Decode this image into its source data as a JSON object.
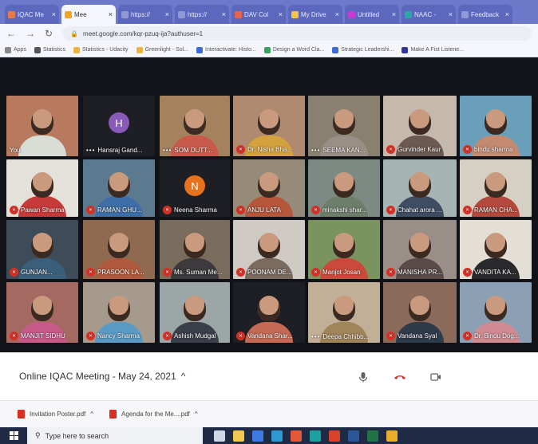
{
  "browser": {
    "tabs": [
      {
        "label": "IQAC Me",
        "active": false,
        "color": "#e67c4a"
      },
      {
        "label": "Mee",
        "active": true,
        "color": "#f4a622"
      },
      {
        "label": "https://",
        "active": false,
        "color": "#8f99d6"
      },
      {
        "label": "https://",
        "active": false,
        "color": "#8f99d6"
      },
      {
        "label": "DAV Col",
        "active": false,
        "color": "#e9644c"
      },
      {
        "label": "My Drive",
        "active": false,
        "color": "#f5c542"
      },
      {
        "label": "Untitled",
        "active": false,
        "color": "#c53bd3"
      },
      {
        "label": "NAAC -",
        "active": false,
        "color": "#2aa6a6"
      },
      {
        "label": "Feedback",
        "active": false,
        "color": "#8f99d6"
      }
    ],
    "url": "meet.google.com/kqr-pzuq-ija?authuser=1",
    "bookmarks": [
      {
        "label": "Apps",
        "color": "#888888"
      },
      {
        "label": "Statistics",
        "color": "#555555"
      },
      {
        "label": "Statistics - Udacity",
        "color": "#f0b23a"
      },
      {
        "label": "Greenlight - Sol...",
        "color": "#f0b23a"
      },
      {
        "label": "Interactivate: Histo...",
        "color": "#3b6bd3"
      },
      {
        "label": "Design a Word Cla...",
        "color": "#3aa35a"
      },
      {
        "label": "Strategic Leadershi...",
        "color": "#3b6bd3"
      },
      {
        "label": "Make A Fist Listene...",
        "color": "#333399"
      }
    ]
  },
  "participants": [
    {
      "name": "You",
      "muted": false,
      "more": false,
      "avatar": "",
      "bg": "#b77a5e",
      "body": "#d9ddd6"
    },
    {
      "name": "Hansraj Gand...",
      "muted": false,
      "more": true,
      "avatar": "H",
      "avatar_color": "#8a5ab8",
      "bg": "#1d1f24",
      "body": ""
    },
    {
      "name": "SOM DUTT...",
      "muted": false,
      "more": true,
      "avatar": "",
      "bg": "#a4825e",
      "body": "#c95a4a"
    },
    {
      "name": "Dr. Nisha Bha...",
      "muted": true,
      "more": false,
      "avatar": "",
      "bg": "#b08a70",
      "body": "#d4a13f"
    },
    {
      "name": "SEEMA KAN...",
      "muted": false,
      "more": true,
      "avatar": "",
      "bg": "#8a8070",
      "body": "#9a8f84"
    },
    {
      "name": "Gurvinder Kaur",
      "muted": true,
      "more": false,
      "avatar": "",
      "bg": "#c4b9aa",
      "body": "#6c5a52"
    },
    {
      "name": "bindu sharma",
      "muted": true,
      "more": false,
      "avatar": "",
      "bg": "#6a9fb9",
      "body": "#c48a70"
    },
    {
      "name": "Pawan Sharma",
      "muted": true,
      "more": false,
      "avatar": "",
      "bg": "#e4e1da",
      "body": "#c73a3a"
    },
    {
      "name": "RAMAN GHU...",
      "muted": true,
      "more": false,
      "avatar": "",
      "bg": "#5b7a8f",
      "body": "#3d6ea8"
    },
    {
      "name": "Neena Sharma",
      "muted": true,
      "more": false,
      "avatar": "N",
      "avatar_color": "#e8711c",
      "bg": "#1d1f24",
      "body": ""
    },
    {
      "name": "ANJU LATA",
      "muted": true,
      "more": false,
      "avatar": "",
      "bg": "#968a78",
      "body": "#b6573c"
    },
    {
      "name": "minakshi shar...",
      "muted": true,
      "more": false,
      "avatar": "",
      "bg": "#7d8a84",
      "body": "#6d7f6a"
    },
    {
      "name": "Chahat arora ...",
      "muted": true,
      "more": false,
      "avatar": "",
      "bg": "#a6b4b4",
      "body": "#3f4d63"
    },
    {
      "name": "RAMAN CHA...",
      "muted": true,
      "more": false,
      "avatar": "",
      "bg": "#d6cfc4",
      "body": "#b4483c"
    },
    {
      "name": "GUNJAN...",
      "muted": true,
      "more": false,
      "avatar": "",
      "bg": "#3d4c58",
      "body": "#3b5e7a"
    },
    {
      "name": "PRASOON LA...",
      "muted": true,
      "more": false,
      "avatar": "",
      "bg": "#8f6a50",
      "body": "#b05a3d"
    },
    {
      "name": "Ms. Suman Me...",
      "muted": true,
      "more": false,
      "avatar": "",
      "bg": "#7a6c5c",
      "body": "#3c3a3c"
    },
    {
      "name": "POONAM DE...",
      "muted": true,
      "more": false,
      "avatar": "",
      "bg": "#cfcbc4",
      "body": "#7b6a5e"
    },
    {
      "name": "Manjot Josan",
      "muted": true,
      "more": false,
      "avatar": "",
      "bg": "#7a9460",
      "body": "#c94a3a"
    },
    {
      "name": "MANISHA PR...",
      "muted": true,
      "more": false,
      "avatar": "",
      "bg": "#9a8f88",
      "body": "#5b4a4a"
    },
    {
      "name": "VANDITA KA...",
      "muted": true,
      "more": false,
      "avatar": "",
      "bg": "#e3ded6",
      "body": "#2a2a2e"
    },
    {
      "name": "MANJIT SIDHU",
      "muted": true,
      "more": false,
      "avatar": "",
      "bg": "#a46a62",
      "body": "#c85a8a"
    },
    {
      "name": "Nancy Sharma",
      "muted": true,
      "more": false,
      "avatar": "",
      "bg": "#a69a8c",
      "body": "#5a9ac4"
    },
    {
      "name": "Ashish Mudgal",
      "muted": true,
      "more": false,
      "avatar": "",
      "bg": "#9ca6a6",
      "body": "#3a3f4a"
    },
    {
      "name": "Vandana Shar...",
      "muted": true,
      "more": false,
      "avatar": "",
      "bg": "#1d1f24",
      "body": "#c46a54"
    },
    {
      "name": "Deepa Chhibb...",
      "muted": false,
      "more": true,
      "avatar": "",
      "bg": "#c2af98",
      "body": "#a0845a"
    },
    {
      "name": "Vandana Syal",
      "muted": true,
      "more": false,
      "avatar": "",
      "bg": "#8a6a5a",
      "body": "#2f3a4a"
    },
    {
      "name": "Dr. Bindu Dog...",
      "muted": true,
      "more": false,
      "avatar": "",
      "bg": "#8ba0b4",
      "body": "#d08a92"
    }
  ],
  "meeting": {
    "title": "Online IQAC Meeting - May 24, 2021",
    "chevron": "^"
  },
  "downloads": [
    {
      "label": "Invitation Poster.pdf"
    },
    {
      "label": "Agenda for the Me....pdf"
    }
  ],
  "taskbar": {
    "search_placeholder": "Type here to search",
    "apps": [
      {
        "name": "task-view",
        "color": "#cfd6e6"
      },
      {
        "name": "file-explorer",
        "color": "#f2c94c"
      },
      {
        "name": "mail",
        "color": "#3d7be0"
      },
      {
        "name": "edge",
        "color": "#2e9ad0"
      },
      {
        "name": "chrome",
        "color": "#e05a3a"
      },
      {
        "name": "chrome-2",
        "color": "#1fa0a0"
      },
      {
        "name": "office",
        "color": "#d9432c"
      },
      {
        "name": "word",
        "color": "#2b579a"
      },
      {
        "name": "excel",
        "color": "#217346"
      },
      {
        "name": "photos",
        "color": "#e8b02a"
      }
    ]
  }
}
